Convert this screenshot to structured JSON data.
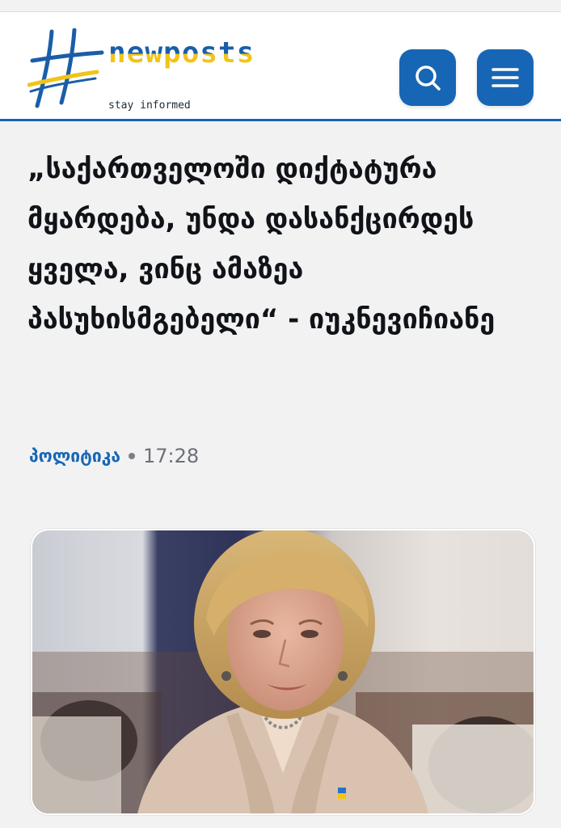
{
  "header": {
    "logo_word": "newposts",
    "logo_tagline": "stay informed",
    "search_icon": "search-icon",
    "menu_icon": "hamburger-menu-icon",
    "accent_color": "#1766b5",
    "logo_yellow": "#f0c419"
  },
  "article": {
    "headline": "„საქართველოში დიქტატურა მყარდება, უნდა დასანქცირდეს ყველა, ვინც ამაზეა პასუხისმგებელი“ - იუკნევიჩიანე",
    "category": "პოლიტიკა",
    "time": "17:28",
    "photo_subject": "woman-portrait"
  }
}
